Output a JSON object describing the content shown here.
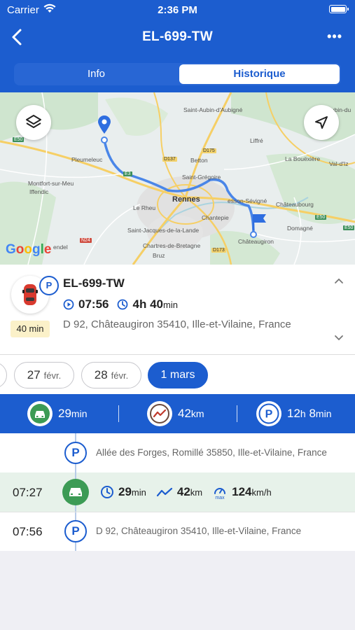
{
  "status_bar": {
    "carrier": "Carrier",
    "time": "2:36 PM"
  },
  "nav": {
    "title": "EL-699-TW",
    "more_label": "•••"
  },
  "tabs": [
    {
      "label": "Info",
      "active": false
    },
    {
      "label": "Historique",
      "active": true
    }
  ],
  "map": {
    "places": {
      "saint_aubin_aubigne": "Saint-Aubin-d'Aubigné",
      "saint_aubin_cormier": "Saint-Aubin-du",
      "pleumeleuc": "Pleumeleuc",
      "montfort": "Montfort-sur-Meu",
      "iffendic": "Iffendic",
      "le_rheu": "Le Rheu",
      "rennes": "Rennes",
      "saint_gregoire": "Saint-Grégoire",
      "betton": "Betton",
      "liffre": "Liffré",
      "la_bouexiere": "La Bouëxière",
      "val_dize": "Val-d'Iz",
      "chateaubourg": "Châteaubourg",
      "chantepie": "Chantepie",
      "saint_jacques": "Saint-Jacques-de-la-Lande",
      "chartres": "Chartres-de-Bretagne",
      "bruz": "Bruz",
      "domagne": "Domagné",
      "chateaugiron": "Châteaugiron",
      "cesson": "esson-Sévigné",
      "gendel": "endel"
    },
    "roads": {
      "e50": "E50",
      "d137": "D137",
      "d175": "D175",
      "e3": "E3",
      "n24": "N24",
      "d173": "D173",
      "e50b": "E50",
      "e50c": "E50"
    },
    "google": [
      "G",
      "o",
      "o",
      "g",
      "l",
      "e"
    ],
    "google_colors": [
      "#4285f4",
      "#ea4335",
      "#fbbc05",
      "#4285f4",
      "#34a853",
      "#ea4335"
    ]
  },
  "summary": {
    "plate": "EL-699-TW",
    "parking_badge": "P",
    "duration_tag": "40 min",
    "time": "07:56",
    "duration_h": "4h",
    "duration_m": "40",
    "duration_unit": "min",
    "address": "D 92, Châteaugiron 35410, Ille-et-Vilaine, France"
  },
  "dates": [
    {
      "day": "27",
      "month": "févr."
    },
    {
      "day": "28",
      "month": "févr."
    },
    {
      "label": "1 mars",
      "active": true
    }
  ],
  "stats": {
    "drive_value": "29",
    "drive_unit": "min",
    "distance_value": "42",
    "distance_unit": "km",
    "parking_h": "12",
    "parking_h_unit": "h",
    "parking_m": "8",
    "parking_m_unit": "min",
    "parking_letter": "P"
  },
  "timeline": [
    {
      "type": "parking",
      "time": "",
      "letter": "P",
      "address": "Allée des Forges, Romillé 35850, Ille-et-Vilaine, France"
    },
    {
      "type": "drive",
      "time": "07:27",
      "duration": "29",
      "duration_unit": "min",
      "distance": "42",
      "distance_unit": "km",
      "max_label": "max",
      "speed": "124",
      "speed_unit": "km/h"
    },
    {
      "type": "parking",
      "time": "07:56",
      "letter": "P",
      "address": "D 92, Châteaugiron 35410, Ille-et-Vilaine, France"
    }
  ],
  "colors": {
    "primary": "#1c5dcf",
    "drive_green": "#3c9b55",
    "tag_yellow": "#fbf1c9",
    "route": "#4a86e8"
  }
}
